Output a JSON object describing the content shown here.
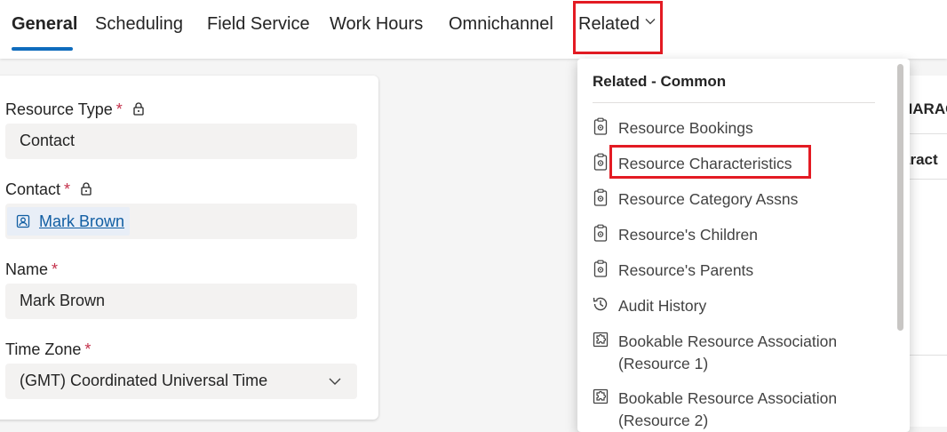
{
  "tabs": [
    {
      "label": "General"
    },
    {
      "label": "Scheduling"
    },
    {
      "label": "Field Service"
    },
    {
      "label": "Work Hours"
    },
    {
      "label": "Omnichannel"
    },
    {
      "label": "Related"
    }
  ],
  "form": {
    "resource_type": {
      "label": "Resource Type",
      "required": "*",
      "value": "Contact"
    },
    "contact": {
      "label": "Contact",
      "required": "*",
      "value": "Mark Brown"
    },
    "name": {
      "label": "Name",
      "required": "*",
      "value": "Mark Brown"
    },
    "time_zone": {
      "label": "Time Zone",
      "required": "*",
      "value": "(GMT) Coordinated Universal Time"
    }
  },
  "right_panel": {
    "header_fragment": "HARAC",
    "row_fragment": "aract"
  },
  "related_menu": {
    "header": "Related - Common",
    "items": [
      {
        "label": "Resource Bookings",
        "icon": "clipboard-gear-icon"
      },
      {
        "label": "Resource Characteristics",
        "icon": "clipboard-gear-icon"
      },
      {
        "label": "Resource Category Assns",
        "icon": "clipboard-gear-icon"
      },
      {
        "label": "Resource's Children",
        "icon": "clipboard-gear-icon"
      },
      {
        "label": "Resource's Parents",
        "icon": "clipboard-gear-icon"
      },
      {
        "label": "Audit History",
        "icon": "history-icon"
      },
      {
        "label": "Bookable Resource Association (Resource 1)",
        "icon": "puzzle-icon"
      },
      {
        "label": "Bookable Resource Association (Resource 2)",
        "icon": "puzzle-icon"
      }
    ]
  },
  "colors": {
    "accent": "#0f6cbd",
    "highlight": "#e31b23",
    "required": "#c4314b",
    "link": "#115ea3"
  }
}
